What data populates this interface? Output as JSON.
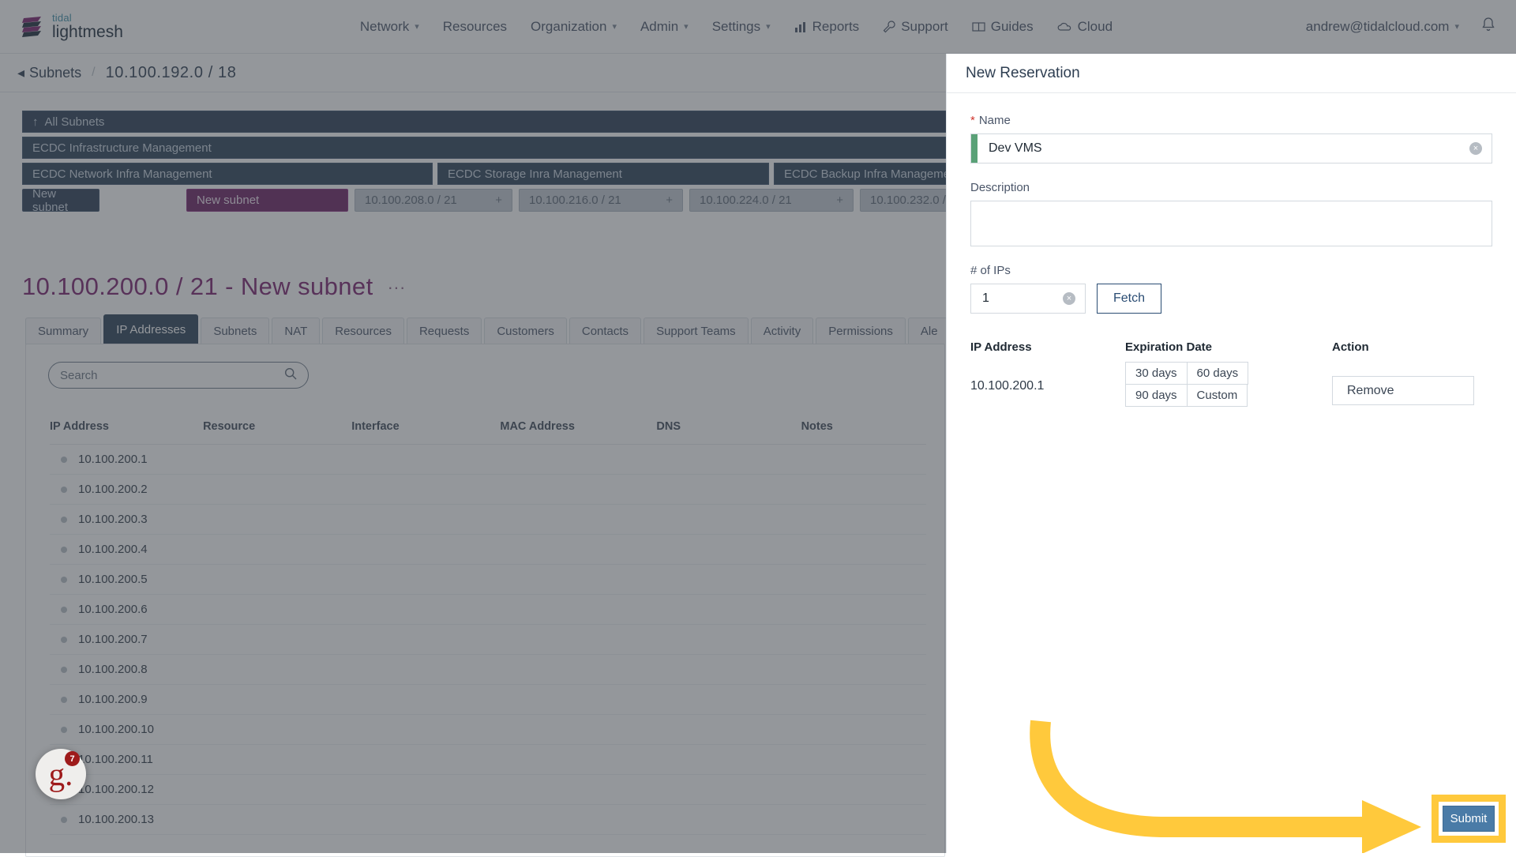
{
  "header": {
    "brand_top": "tidal",
    "brand_bottom": "lightmesh",
    "nav": [
      {
        "label": "Network",
        "caret": true,
        "icon": null
      },
      {
        "label": "Resources",
        "caret": false,
        "icon": null
      },
      {
        "label": "Organization",
        "caret": true,
        "icon": null
      },
      {
        "label": "Admin",
        "caret": true,
        "icon": null
      },
      {
        "label": "Settings",
        "caret": true,
        "icon": null
      },
      {
        "label": "Reports",
        "caret": false,
        "icon": "chart-bar-icon"
      },
      {
        "label": "Support",
        "caret": false,
        "icon": "wrench-icon"
      },
      {
        "label": "Guides",
        "caret": false,
        "icon": "book-icon"
      },
      {
        "label": "Cloud",
        "caret": false,
        "icon": "cloud-icon"
      }
    ],
    "account": "andrew@tidalcloud.com",
    "account_caret": "∨",
    "notifications_icon": "bell-icon"
  },
  "breadcrumb": {
    "back_arrow": "◂",
    "parent": "Subnets",
    "separator": "/",
    "current": "10.100.192.0 / 18"
  },
  "hierarchy": {
    "all_subnets": "All Subnets",
    "up_arrow": "↑",
    "level1": "ECDC Infrastructure Management",
    "level2": [
      "ECDC Network Infra Management",
      "ECDC Storage Inra Management",
      "ECDC Backup Infra Management"
    ],
    "chips": [
      {
        "label": "New subnet",
        "style": "dark",
        "plus": ""
      },
      {
        "label": "New subnet",
        "style": "purple",
        "plus": ""
      },
      {
        "label": "10.100.208.0 / 21",
        "style": "light",
        "plus": "+"
      },
      {
        "label": "10.100.216.0 / 21",
        "style": "light",
        "plus": "+"
      },
      {
        "label": "10.100.224.0 / 21",
        "style": "light",
        "plus": "+"
      },
      {
        "label": "10.100.232.0 /",
        "style": "light",
        "plus": ""
      }
    ]
  },
  "page": {
    "title": "10.100.200.0 / 21 - New subnet",
    "menu_dots": "···"
  },
  "tabs": [
    {
      "label": "Summary",
      "active": false
    },
    {
      "label": "IP Addresses",
      "active": true
    },
    {
      "label": "Subnets",
      "active": false
    },
    {
      "label": "NAT",
      "active": false
    },
    {
      "label": "Resources",
      "active": false
    },
    {
      "label": "Requests",
      "active": false
    },
    {
      "label": "Customers",
      "active": false
    },
    {
      "label": "Contacts",
      "active": false
    },
    {
      "label": "Support Teams",
      "active": false
    },
    {
      "label": "Activity",
      "active": false
    },
    {
      "label": "Permissions",
      "active": false
    },
    {
      "label": "Ale",
      "active": false
    }
  ],
  "table": {
    "search_placeholder": "Search",
    "search_value": "",
    "search_icon": "search-icon",
    "columns": [
      "IP Address",
      "Resource",
      "Interface",
      "MAC Address",
      "DNS",
      "Notes"
    ],
    "rows": [
      {
        "ip": "10.100.200.1",
        "resource": "",
        "interface": "",
        "mac": "",
        "dns": "",
        "notes": ""
      },
      {
        "ip": "10.100.200.2",
        "resource": "",
        "interface": "",
        "mac": "",
        "dns": "",
        "notes": ""
      },
      {
        "ip": "10.100.200.3",
        "resource": "",
        "interface": "",
        "mac": "",
        "dns": "",
        "notes": ""
      },
      {
        "ip": "10.100.200.4",
        "resource": "",
        "interface": "",
        "mac": "",
        "dns": "",
        "notes": ""
      },
      {
        "ip": "10.100.200.5",
        "resource": "",
        "interface": "",
        "mac": "",
        "dns": "",
        "notes": ""
      },
      {
        "ip": "10.100.200.6",
        "resource": "",
        "interface": "",
        "mac": "",
        "dns": "",
        "notes": ""
      },
      {
        "ip": "10.100.200.7",
        "resource": "",
        "interface": "",
        "mac": "",
        "dns": "",
        "notes": ""
      },
      {
        "ip": "10.100.200.8",
        "resource": "",
        "interface": "",
        "mac": "",
        "dns": "",
        "notes": ""
      },
      {
        "ip": "10.100.200.9",
        "resource": "",
        "interface": "",
        "mac": "",
        "dns": "",
        "notes": ""
      },
      {
        "ip": "10.100.200.10",
        "resource": "",
        "interface": "",
        "mac": "",
        "dns": "",
        "notes": ""
      },
      {
        "ip": "10.100.200.11",
        "resource": "",
        "interface": "",
        "mac": "",
        "dns": "",
        "notes": ""
      },
      {
        "ip": "10.100.200.12",
        "resource": "",
        "interface": "",
        "mac": "",
        "dns": "",
        "notes": ""
      },
      {
        "ip": "10.100.200.13",
        "resource": "",
        "interface": "",
        "mac": "",
        "dns": "",
        "notes": ""
      }
    ]
  },
  "drawer": {
    "title": "New Reservation",
    "name_label": "Name",
    "name_required_marker": "*",
    "name_value": "Dev VMS",
    "name_clear_icon": "×",
    "description_label": "Description",
    "description_value": "",
    "ips_label": "# of IPs",
    "ips_value": "1",
    "ips_clear_icon": "×",
    "fetch_label": "Fetch",
    "reservation_columns": [
      "IP Address",
      "Expiration Date",
      "Action"
    ],
    "reservation_rows": [
      {
        "ip": "10.100.200.1",
        "expiration_options": [
          "30 days",
          "60 days",
          "90 days",
          "Custom"
        ],
        "action": "Remove"
      }
    ],
    "submit_label": "Submit"
  },
  "annotation": {
    "arrow_color": "#ffc93c",
    "highlight_color": "#ffc93c"
  },
  "helper_badge": {
    "glyph": "g.",
    "count": "7"
  },
  "colors": {
    "brand_teal": "#3d8fa8",
    "brand_purple": "#7b1f6e",
    "tab_active": "#2a4158",
    "accent_green": "#5aa177",
    "submit_blue": "#4a7ba7"
  }
}
